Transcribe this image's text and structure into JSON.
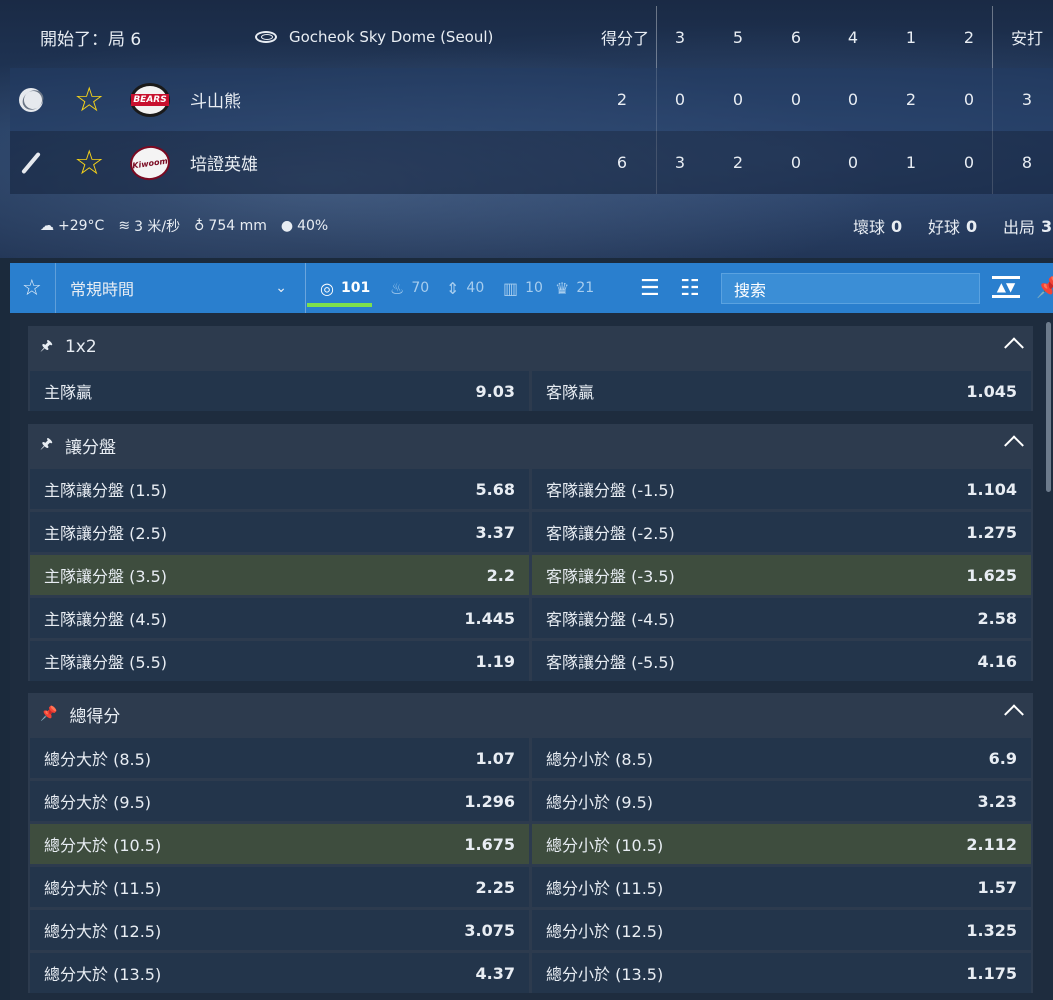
{
  "scoreboard": {
    "status": "開始了：局 6",
    "venue": "Gocheok Sky Dome (Seoul)",
    "score_label": "得分了",
    "innings": [
      "3",
      "5",
      "6",
      "4",
      "1",
      "2"
    ],
    "hits_label": "安打",
    "teams": [
      {
        "name": "斗山熊",
        "logo": "bears-logo",
        "role_icon": "baseball-icon",
        "total": "2",
        "innings": [
          "0",
          "0",
          "0",
          "0",
          "2",
          "0"
        ],
        "hits": "3"
      },
      {
        "name": "培證英雄",
        "logo": "kiwoom-logo",
        "role_icon": "bat-icon",
        "total": "6",
        "innings": [
          "3",
          "2",
          "0",
          "0",
          "1",
          "0"
        ],
        "hits": "8"
      }
    ],
    "weather": {
      "temp": "+29°C",
      "wind": "3 米/秒",
      "rain": "754 mm",
      "humidity": "40%"
    },
    "count": {
      "balls_label": "壞球",
      "balls": "0",
      "strikes_label": "好球",
      "strikes": "0",
      "outs_label": "出局",
      "outs": "3"
    }
  },
  "toolbar": {
    "period": "常規時間",
    "filters": [
      {
        "icon": "target-icon",
        "count": "101",
        "active": true
      },
      {
        "icon": "fire-icon",
        "count": "70",
        "active": false
      },
      {
        "icon": "updown-icon",
        "count": "40",
        "active": false
      },
      {
        "icon": "chart-icon",
        "count": "10",
        "active": false
      },
      {
        "icon": "trophy-icon",
        "count": "21",
        "active": false
      }
    ],
    "search_placeholder": "搜索"
  },
  "markets": [
    {
      "title": "1x2",
      "rows": [
        {
          "left_label": "主隊贏",
          "left_odd": "9.03",
          "right_label": "客隊贏",
          "right_odd": "1.045",
          "highlight": false
        }
      ]
    },
    {
      "title": "讓分盤",
      "rows": [
        {
          "left_label": "主隊讓分盤 (1.5)",
          "left_odd": "5.68",
          "right_label": "客隊讓分盤 (-1.5)",
          "right_odd": "1.104",
          "highlight": false
        },
        {
          "left_label": "主隊讓分盤 (2.5)",
          "left_odd": "3.37",
          "right_label": "客隊讓分盤 (-2.5)",
          "right_odd": "1.275",
          "highlight": false
        },
        {
          "left_label": "主隊讓分盤 (3.5)",
          "left_odd": "2.2",
          "right_label": "客隊讓分盤 (-3.5)",
          "right_odd": "1.625",
          "highlight": true
        },
        {
          "left_label": "主隊讓分盤 (4.5)",
          "left_odd": "1.445",
          "right_label": "客隊讓分盤 (-4.5)",
          "right_odd": "2.58",
          "highlight": false
        },
        {
          "left_label": "主隊讓分盤 (5.5)",
          "left_odd": "1.19",
          "right_label": "客隊讓分盤 (-5.5)",
          "right_odd": "4.16",
          "highlight": false
        }
      ]
    },
    {
      "title": "總得分",
      "rows": [
        {
          "left_label": "總分大於 (8.5)",
          "left_odd": "1.07",
          "right_label": "總分小於 (8.5)",
          "right_odd": "6.9",
          "highlight": false
        },
        {
          "left_label": "總分大於 (9.5)",
          "left_odd": "1.296",
          "right_label": "總分小於 (9.5)",
          "right_odd": "3.23",
          "highlight": false
        },
        {
          "left_label": "總分大於 (10.5)",
          "left_odd": "1.675",
          "right_label": "總分小於 (10.5)",
          "right_odd": "2.112",
          "highlight": true
        },
        {
          "left_label": "總分大於 (11.5)",
          "left_odd": "2.25",
          "right_label": "總分小於 (11.5)",
          "right_odd": "1.57",
          "highlight": false
        },
        {
          "left_label": "總分大於 (12.5)",
          "left_odd": "3.075",
          "right_label": "總分小於 (12.5)",
          "right_odd": "1.325",
          "highlight": false
        },
        {
          "left_label": "總分大於 (13.5)",
          "left_odd": "4.37",
          "right_label": "總分小於 (13.5)",
          "right_odd": "1.175",
          "highlight": false
        }
      ]
    }
  ],
  "colors": {
    "accent": "#2a7fce",
    "active_underline": "#7ee04b",
    "star": "#f5d21a",
    "highlight_row": "#3e4d3e"
  }
}
